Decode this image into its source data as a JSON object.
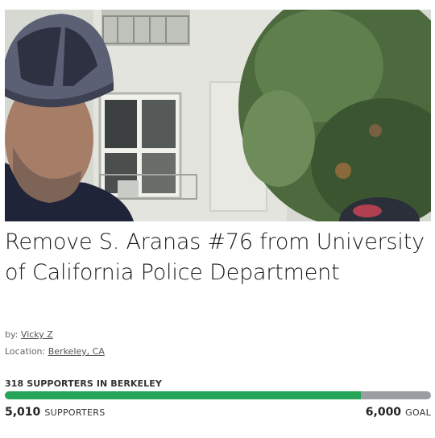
{
  "petition": {
    "title": "Remove S. Aranas #76 from University of California Police Department",
    "by_prefix": "by:",
    "author": "Vicky Z",
    "location_prefix": "Location:",
    "location": "Berkeley, CA"
  },
  "progress": {
    "local_supporters_label": "318 SUPPORTERS IN BERKELEY",
    "supporters_count": "5,010",
    "supporters_label": "SUPPORTERS",
    "goal_count": "6,000",
    "goal_label": "GOAL",
    "fraction": 0.835,
    "fill_color": "#24a456",
    "track_color": "#9a9ea3"
  }
}
